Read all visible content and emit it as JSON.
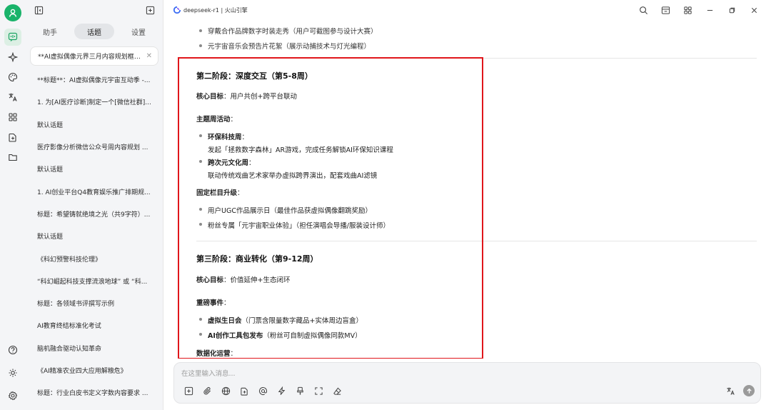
{
  "app": {
    "title": "deepseek-r1 | 火山引擎",
    "brand_color": "#19b36a",
    "highlight_color": "#e0161b"
  },
  "sidebar": {
    "tabs": [
      {
        "label": "助手"
      },
      {
        "label": "话题",
        "active": true
      },
      {
        "label": "设置"
      }
    ],
    "topics": [
      "**AI虚拟偶像元界三月内容规划框架*...",
      "**标题**：AI虚拟偶像元宇宙互动季 -...",
      "1. 为[AI医疗诊断]制定一个[微信社群]...",
      "默认话题",
      "医疗影像分析微信公众号周内容规划 ...",
      "默认话题",
      "1. AI创业平台Q4教育娱乐推广排期规...",
      "标题：希望铸就绝境之光（共9字符）...",
      "默认话题",
      "《科幻预警科技伦理》",
      "“科幻崛起科技支撑流浪地球” 或 “科...",
      "标题：各领域书评撰写示例",
      "AI教育终结标准化考试",
      "脑机融合驱动认知革命",
      "《AI精准农业四大应用解粮危》",
      "标题：行业白皮书定义字数内容要求 ..."
    ]
  },
  "content": {
    "prev_items": [
      "穿戴合作品牌数字时装走秀（用户可截图参与设计大赛）",
      "元宇宙音乐会预告片花絮（展示动捕技术与灯光编程）"
    ],
    "phase2": {
      "title": "第二阶段：深度交互（第5-8周）",
      "core_label": "核心目标",
      "core_value": "：用户共创+跨平台联动",
      "theme_label": "主题周活动",
      "theme_colon": "：",
      "items": [
        {
          "bold": "环保科技周",
          "colon": "：",
          "desc": "发起「拯救数字森林」AR游戏，完成任务解锁AI环保知识课程"
        },
        {
          "bold": "跨次元文化周",
          "colon": "：",
          "desc": "联动传统戏曲艺术家举办虚拟跨界演出，配套戏曲AI滤镜"
        }
      ],
      "fixed_label": "固定栏目升级",
      "fixed_colon": "：",
      "fixed_items": [
        "用户UGC作品展示日（最佳作品获虚拟偶像翻跳奖励）",
        "粉丝专属「元宇宙职业体验」（担任演唱会导播/服装设计师）"
      ]
    },
    "phase3": {
      "title": "第三阶段：商业转化（第9-12周）",
      "core_label": "核心目标",
      "core_value": "：价值延伸+生态闭环",
      "major_label": "重磅事件",
      "major_colon": "：",
      "items": [
        {
          "bold": "虚拟生日会",
          "desc": "（门票含限量数字藏品+实体周边盲盒）"
        },
        {
          "bold": "AI创作工具包发布",
          "desc": "（粉丝可自制虚拟偶像同款MV）"
        }
      ],
      "data_label": "数据化运营",
      "data_colon": "："
    }
  },
  "input": {
    "placeholder": "在这里输入消息..."
  }
}
